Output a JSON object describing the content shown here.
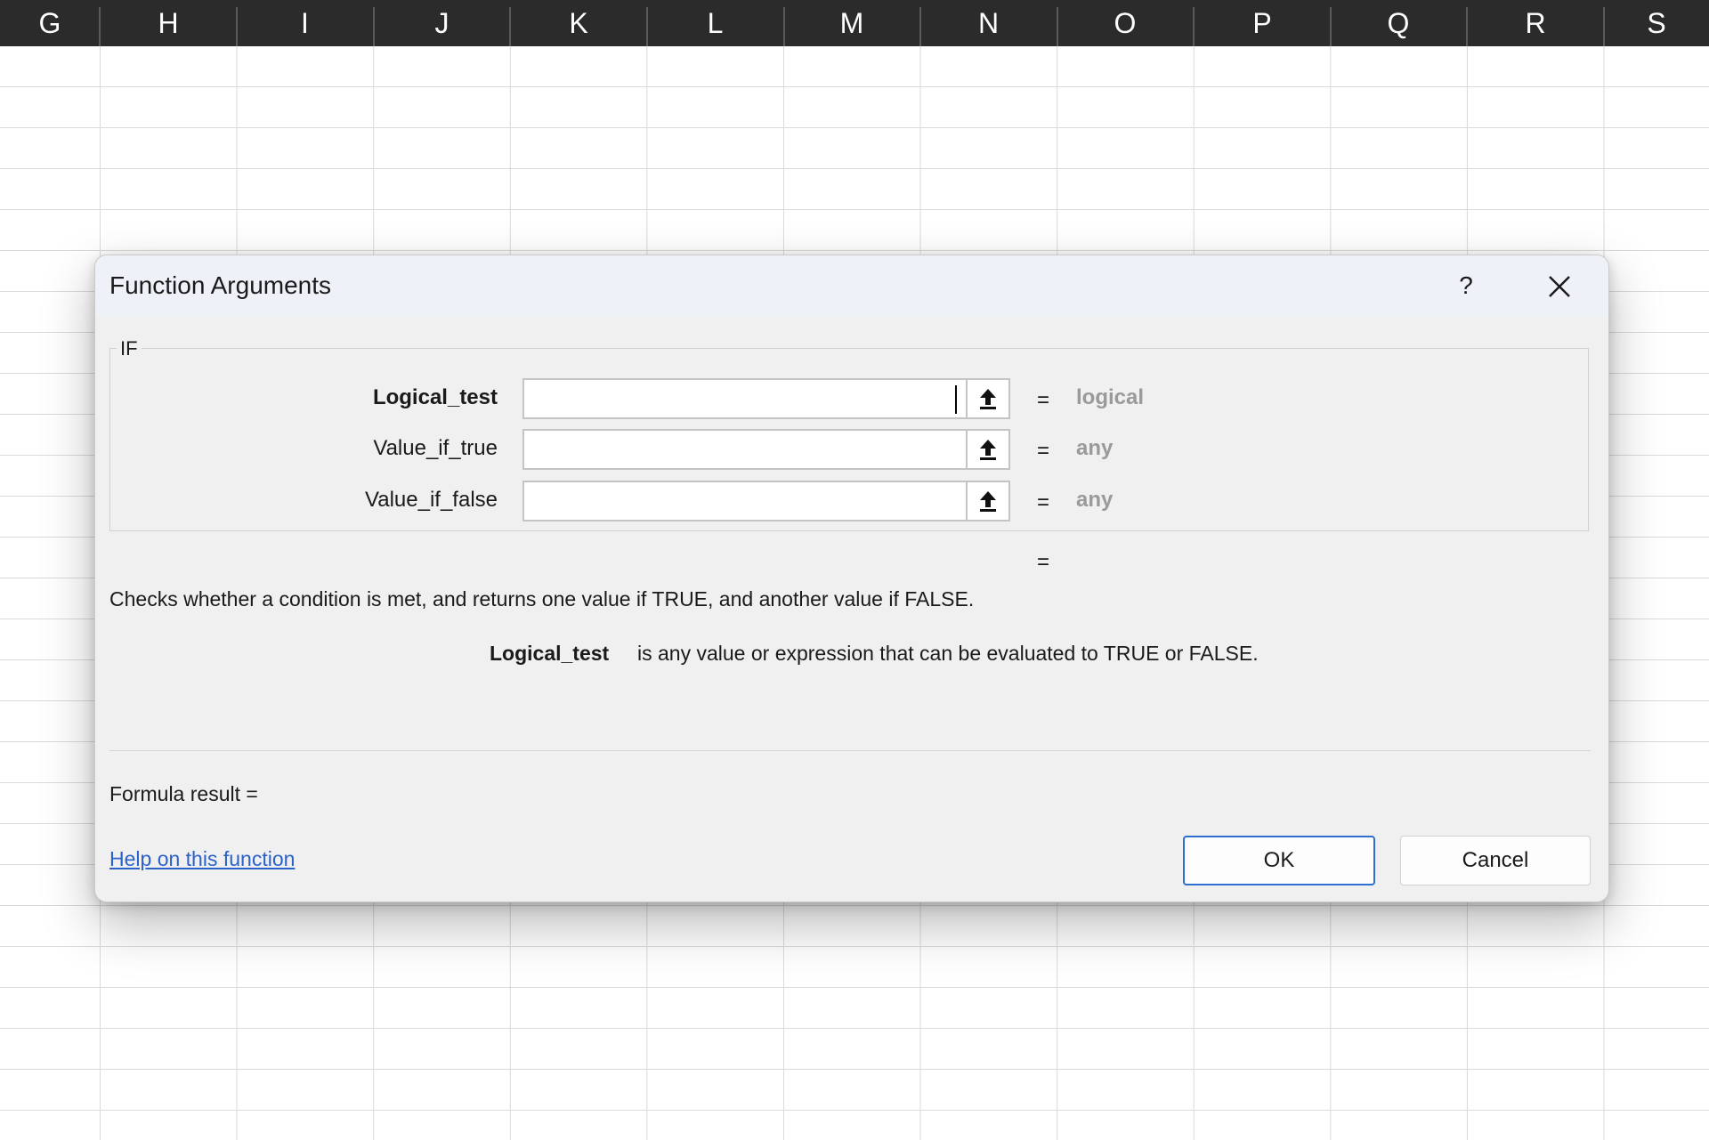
{
  "columns": [
    "G",
    "H",
    "I",
    "J",
    "K",
    "L",
    "M",
    "N",
    "O",
    "P",
    "Q",
    "R",
    "S"
  ],
  "dialog": {
    "title": "Function Arguments",
    "help_symbol": "?",
    "function_name": "IF",
    "arguments": [
      {
        "label": "Logical_test",
        "value": "",
        "equals": "=",
        "type": "logical"
      },
      {
        "label": "Value_if_true",
        "value": "",
        "equals": "=",
        "type": "any"
      },
      {
        "label": "Value_if_false",
        "value": "",
        "equals": "=",
        "type": "any"
      }
    ],
    "result_equals": "=",
    "description": "Checks whether a condition is met, and returns one value if TRUE, and another value if FALSE.",
    "arg_help": {
      "name": "Logical_test",
      "text": "is any value or expression that can be evaluated to TRUE or FALSE."
    },
    "formula_result": "Formula result =",
    "help_link": "Help on this function",
    "ok_label": "OK",
    "cancel_label": "Cancel",
    "accent_color": "#2f6fd0",
    "link_color": "#2a62c9"
  }
}
